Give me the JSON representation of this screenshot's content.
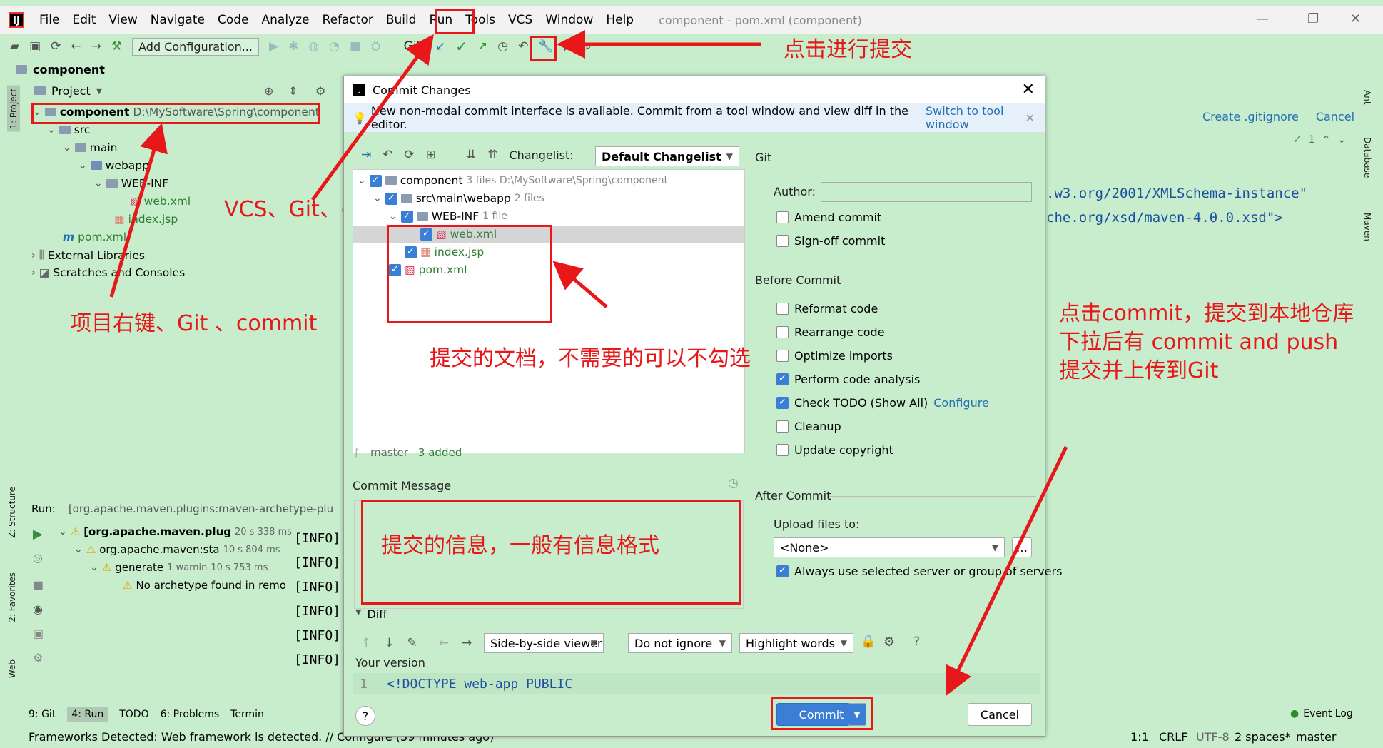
{
  "menubar": {
    "logo": "IJ",
    "items": [
      "File",
      "Edit",
      "View",
      "Navigate",
      "Code",
      "Analyze",
      "Refactor",
      "Build",
      "Run",
      "Tools",
      "VCS",
      "Window",
      "Help"
    ],
    "title": "component - pom.xml (component)"
  },
  "toolbar": {
    "add_configuration": "Add Configuration...",
    "git_label": "Git:"
  },
  "breadcrumb": "component",
  "project_panel": {
    "header": "Project",
    "root_name": "component",
    "root_path": "D:\\MySoftware\\Spring\\component",
    "src": "src",
    "main": "main",
    "webapp": "webapp",
    "webinf": "WEB-INF",
    "webxml": "web.xml",
    "indexjsp": "index.jsp",
    "pomxml": "pom.xml",
    "ext_libs": "External Libraries",
    "scratches": "Scratches and Consoles"
  },
  "annotations": {
    "commit_hint": "点击进行提交",
    "vcs_git_commit": "VCS、Git、commit",
    "project_right_click": "项目右键、Git 、commit",
    "files_note": "提交的文档，不需要的可以不勾选",
    "message_note": "提交的信息，一般有信息格式",
    "commit_note_1": "点击commit，提交到本地仓库",
    "commit_note_2": "下拉后有 commit and push",
    "commit_note_3": "提交并上传到Git"
  },
  "dialog": {
    "title": "Commit Changes",
    "banner_text": "New non-modal commit interface is available. Commit from a tool window and view diff in the editor.",
    "banner_link": "Switch to tool window",
    "changelist_label": "Changelist:",
    "changelist_value": "Default Changelist",
    "git_header": "Git",
    "tree": {
      "root": "component",
      "root_meta": "3 files  D:\\MySoftware\\Spring\\component",
      "webapp": "src\\main\\webapp",
      "webapp_meta": "2 files",
      "webinf": "WEB-INF",
      "webinf_meta": "1 file",
      "webxml": "web.xml",
      "indexjsp": "index.jsp",
      "pomxml": "pom.xml"
    },
    "branch": "master",
    "added": "3 added",
    "commit_message_label": "Commit Message",
    "author_label": "Author:",
    "amend": "Amend commit",
    "signoff": "Sign-off commit",
    "before_commit": "Before Commit",
    "before_opts": [
      {
        "label": "Reformat code",
        "checked": false
      },
      {
        "label": "Rearrange code",
        "checked": false
      },
      {
        "label": "Optimize imports",
        "checked": false
      },
      {
        "label": "Perform code analysis",
        "checked": true
      },
      {
        "label": "Check TODO (Show All)",
        "checked": true
      },
      {
        "label": "Cleanup",
        "checked": false
      },
      {
        "label": "Update copyright",
        "checked": false
      }
    ],
    "configure_link": "Configure",
    "after_commit": "After Commit",
    "upload_label": "Upload files to:",
    "upload_value": "<None>",
    "always_use": "Always use selected server or group of servers",
    "diff_label": "Diff",
    "viewer": "Side-by-side viewer",
    "ignore": "Do not ignore",
    "highlight": "Highlight words",
    "your_version": "Your version",
    "code_line_no": "1",
    "code_line": "<!DOCTYPE web-app PUBLIC",
    "commit_button": "Commit",
    "cancel_button": "Cancel"
  },
  "editor": {
    "create_gitignore": "Create .gitignore",
    "cancel": "Cancel",
    "line1": ".w3.org/2001/XMLSchema-instance\"",
    "line2": "che.org/xsd/maven-4.0.0.xsd\">",
    "check_count": "1"
  },
  "run_panel": {
    "label": "Run:",
    "tab": "[org.apache.maven.plugins:maven-archetype-plu",
    "rows": [
      {
        "text": "[org.apache.maven.plug",
        "time": "20 s 338 ms"
      },
      {
        "text": "org.apache.maven:sta",
        "time": "10 s 804 ms"
      },
      {
        "text": "generate",
        "meta": "1 warnin",
        "time": "10 s 753 ms"
      },
      {
        "text": "No archetype found in remo"
      }
    ],
    "info": "[INFO]"
  },
  "bottom_tabs": [
    "9: Git",
    "4: Run",
    "TODO",
    "6: Problems",
    "Termin"
  ],
  "right_stripe": [
    "Ant",
    "Database",
    "Maven"
  ],
  "left_stripe": [
    "1: Project",
    "Z: Structure",
    "2: Favorites",
    "Web"
  ],
  "statusbar": {
    "text": "Frameworks Detected: Web framework is detected. // Configure (39 minutes ago)",
    "position": "1:1",
    "crlf": "CRLF",
    "encoding": "UTF-8",
    "indent": "2 spaces*",
    "branch": "master",
    "event_log": "Event Log"
  }
}
